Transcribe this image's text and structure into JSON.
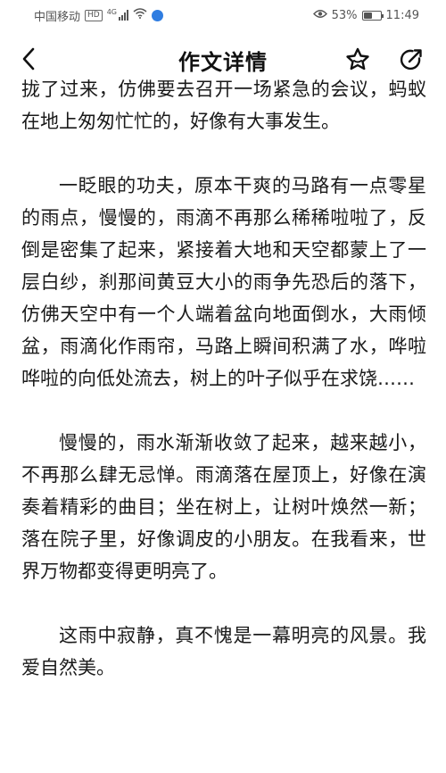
{
  "status_bar": {
    "carrier": "中国移动",
    "hd": "HD",
    "network": "4G",
    "battery_percent": "53%",
    "battery_level": 0.53,
    "time": "11:49"
  },
  "header": {
    "title": "作文详情",
    "back_icon": "chevron-left-icon",
    "favorite_icon": "star-icon",
    "share_icon": "share-arrow-icon"
  },
  "article": {
    "paragraphs": [
      "拢了过来，仿佛要去召开一场紧急的会议，蚂蚁在地上匆匆忙忙的，好像有大事发生。",
      "一眨眼的功夫，原本干爽的马路有一点零星的雨点，慢慢的，雨滴不再那么稀稀啦啦了，反倒是密集了起来，紧接着大地和天空都蒙上了一层白纱，刹那间黄豆大小的雨争先恐后的落下，仿佛天空中有一个人端着盆向地面倒水，大雨倾盆，雨滴化作雨帘，马路上瞬间积满了水，哗啦哗啦的向低处流去，树上的叶子似乎在求饶……",
      "慢慢的，雨水渐渐收敛了起来，越来越小，不再那么肆无忌惮。雨滴落在屋顶上，好像在演奏着精彩的曲目；坐在树上，让树叶焕然一新；落在院子里，好像调皮的小朋友。在我看来，世界万物都变得更明亮了。",
      "这雨中寂静，真不愧是一幕明亮的风景。我爱自然美。"
    ]
  }
}
